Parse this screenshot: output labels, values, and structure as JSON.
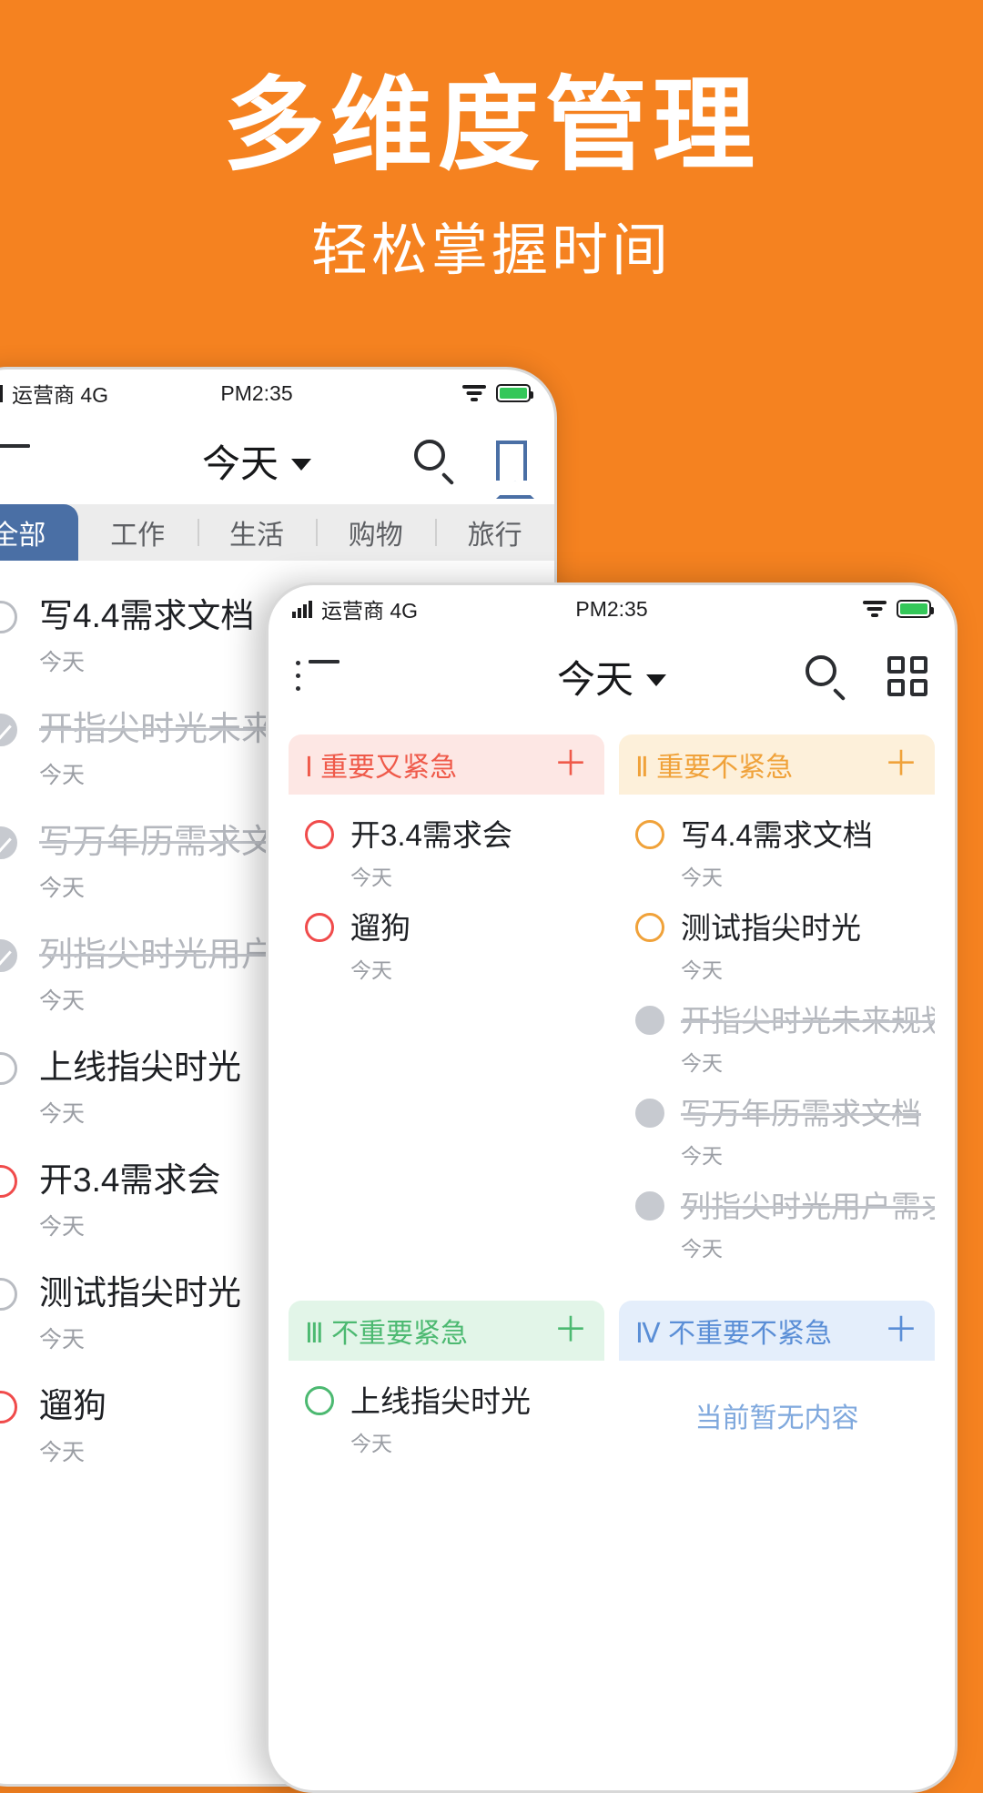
{
  "hero": {
    "title": "多维度管理",
    "subtitle": "轻松掌握时间",
    "bg_color": "#F58220"
  },
  "phone_list": {
    "statusbar": {
      "carrier": "运营商 4G",
      "time": "PM2:35",
      "signal_icon": "signal-bars-icon",
      "wifi_icon": "wifi-icon",
      "battery_icon": "battery-icon"
    },
    "navbar": {
      "menu_icon": "list-menu-icon",
      "title": "今天",
      "caret_icon": "chevron-down-icon",
      "search_icon": "search-icon",
      "bookmark_icon": "bookmark-icon"
    },
    "tabs": [
      {
        "label": "全部",
        "active": true
      },
      {
        "label": "工作",
        "active": false
      },
      {
        "label": "生活",
        "active": false
      },
      {
        "label": "购物",
        "active": false
      },
      {
        "label": "旅行",
        "active": false
      }
    ],
    "tasks": [
      {
        "title": "写4.4需求文档",
        "meta": "今天",
        "state": "open",
        "color": "gray"
      },
      {
        "title": "开指尖时光未来规划",
        "meta": "今天",
        "state": "done",
        "color": "gray"
      },
      {
        "title": "写万年历需求文档",
        "meta": "今天",
        "state": "done",
        "color": "gray"
      },
      {
        "title": "列指尖时光用户需求",
        "meta": "今天",
        "state": "done",
        "color": "gray"
      },
      {
        "title": "上线指尖时光",
        "meta": "今天",
        "state": "open",
        "color": "gray"
      },
      {
        "title": "开3.4需求会",
        "meta": "今天",
        "state": "open",
        "color": "red"
      },
      {
        "title": "测试指尖时光",
        "meta": "今天",
        "state": "open",
        "color": "gray"
      },
      {
        "title": "遛狗",
        "meta": "今天",
        "state": "open",
        "color": "red"
      }
    ]
  },
  "phone_quadrant": {
    "statusbar": {
      "carrier": "运营商 4G",
      "time": "PM2:35",
      "signal_icon": "signal-bars-icon",
      "wifi_icon": "wifi-icon",
      "battery_icon": "battery-icon"
    },
    "navbar": {
      "menu_icon": "list-menu-icon",
      "title": "今天",
      "caret_icon": "chevron-down-icon",
      "search_icon": "search-icon",
      "grid_icon": "quadrant-grid-icon"
    },
    "quadrants": [
      {
        "label": "Ⅰ 重要又紧急",
        "add": "＋",
        "accent": "#ef5a4a",
        "tasks": [
          {
            "title": "开3.4需求会",
            "meta": "今天",
            "state": "open"
          },
          {
            "title": "遛狗",
            "meta": "今天",
            "state": "open"
          }
        ]
      },
      {
        "label": "Ⅱ 重要不紧急",
        "add": "＋",
        "accent": "#f0a23a",
        "tasks": [
          {
            "title": "写4.4需求文档",
            "meta": "今天",
            "state": "open"
          },
          {
            "title": "测试指尖时光",
            "meta": "今天",
            "state": "open"
          },
          {
            "title": "开指尖时光未来规划",
            "meta": "今天",
            "state": "done"
          },
          {
            "title": "写万年历需求文档",
            "meta": "今天",
            "state": "done"
          },
          {
            "title": "列指尖时光用户需求",
            "meta": "今天",
            "state": "done"
          }
        ]
      },
      {
        "label": "Ⅲ 不重要紧急",
        "add": "＋",
        "accent": "#4cb971",
        "tasks": [
          {
            "title": "上线指尖时光",
            "meta": "今天",
            "state": "open"
          }
        ]
      },
      {
        "label": "Ⅳ 不重要不紧急",
        "add": "＋",
        "accent": "#5a8ed6",
        "tasks": [],
        "empty_text": "当前暂无内容"
      }
    ]
  }
}
